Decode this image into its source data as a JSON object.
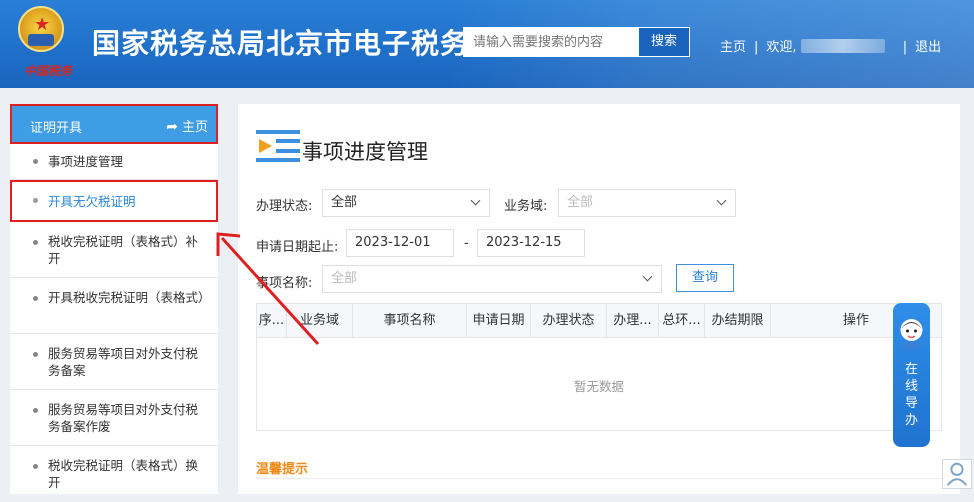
{
  "header": {
    "title": "国家税务总局北京市电子税务局",
    "emblem_text": "中国税务",
    "search": {
      "placeholder": "请输入需要搜索的内容",
      "button": "搜索"
    },
    "links": {
      "home": "主页",
      "welcome": "欢迎,",
      "logout": "退出"
    }
  },
  "sidebar": {
    "title": "证明开具",
    "home": "主页",
    "items": [
      {
        "label": "事项进度管理"
      },
      {
        "label": "开具无欠税证明",
        "active": true
      },
      {
        "label": "税收完税证明（表格式）补开"
      },
      {
        "label": "开具税收完税证明（表格式）"
      },
      {
        "label": "服务贸易等项目对外支付税务备案"
      },
      {
        "label": "服务贸易等项目对外支付税务备案作废"
      },
      {
        "label": "税收完税证明（表格式）换开"
      }
    ]
  },
  "main": {
    "title": "事项进度管理",
    "filters": {
      "status_label": "办理状态:",
      "status_value": "全部",
      "domain_label": "业务域:",
      "domain_value": "全部",
      "date_label": "申请日期起止:",
      "date_from": "2023-12-01",
      "date_sep": "-",
      "date_to": "2023-12-15",
      "item_label": "事项名称:",
      "item_value": "全部",
      "query_button": "查询"
    },
    "table": {
      "columns": [
        "序...",
        "业务域",
        "事项名称",
        "申请日期",
        "办理状态",
        "办理...",
        "总环...",
        "办结期限",
        "操作"
      ],
      "empty": "暂无数据"
    },
    "tip_title": "温馨提示"
  },
  "guide": {
    "text": [
      "在",
      "线",
      "导",
      "办"
    ]
  },
  "colors": {
    "brand": "#1f6fc9",
    "accent": "#3f9de6",
    "highlight": "#e02020",
    "tip": "#f08a16"
  }
}
